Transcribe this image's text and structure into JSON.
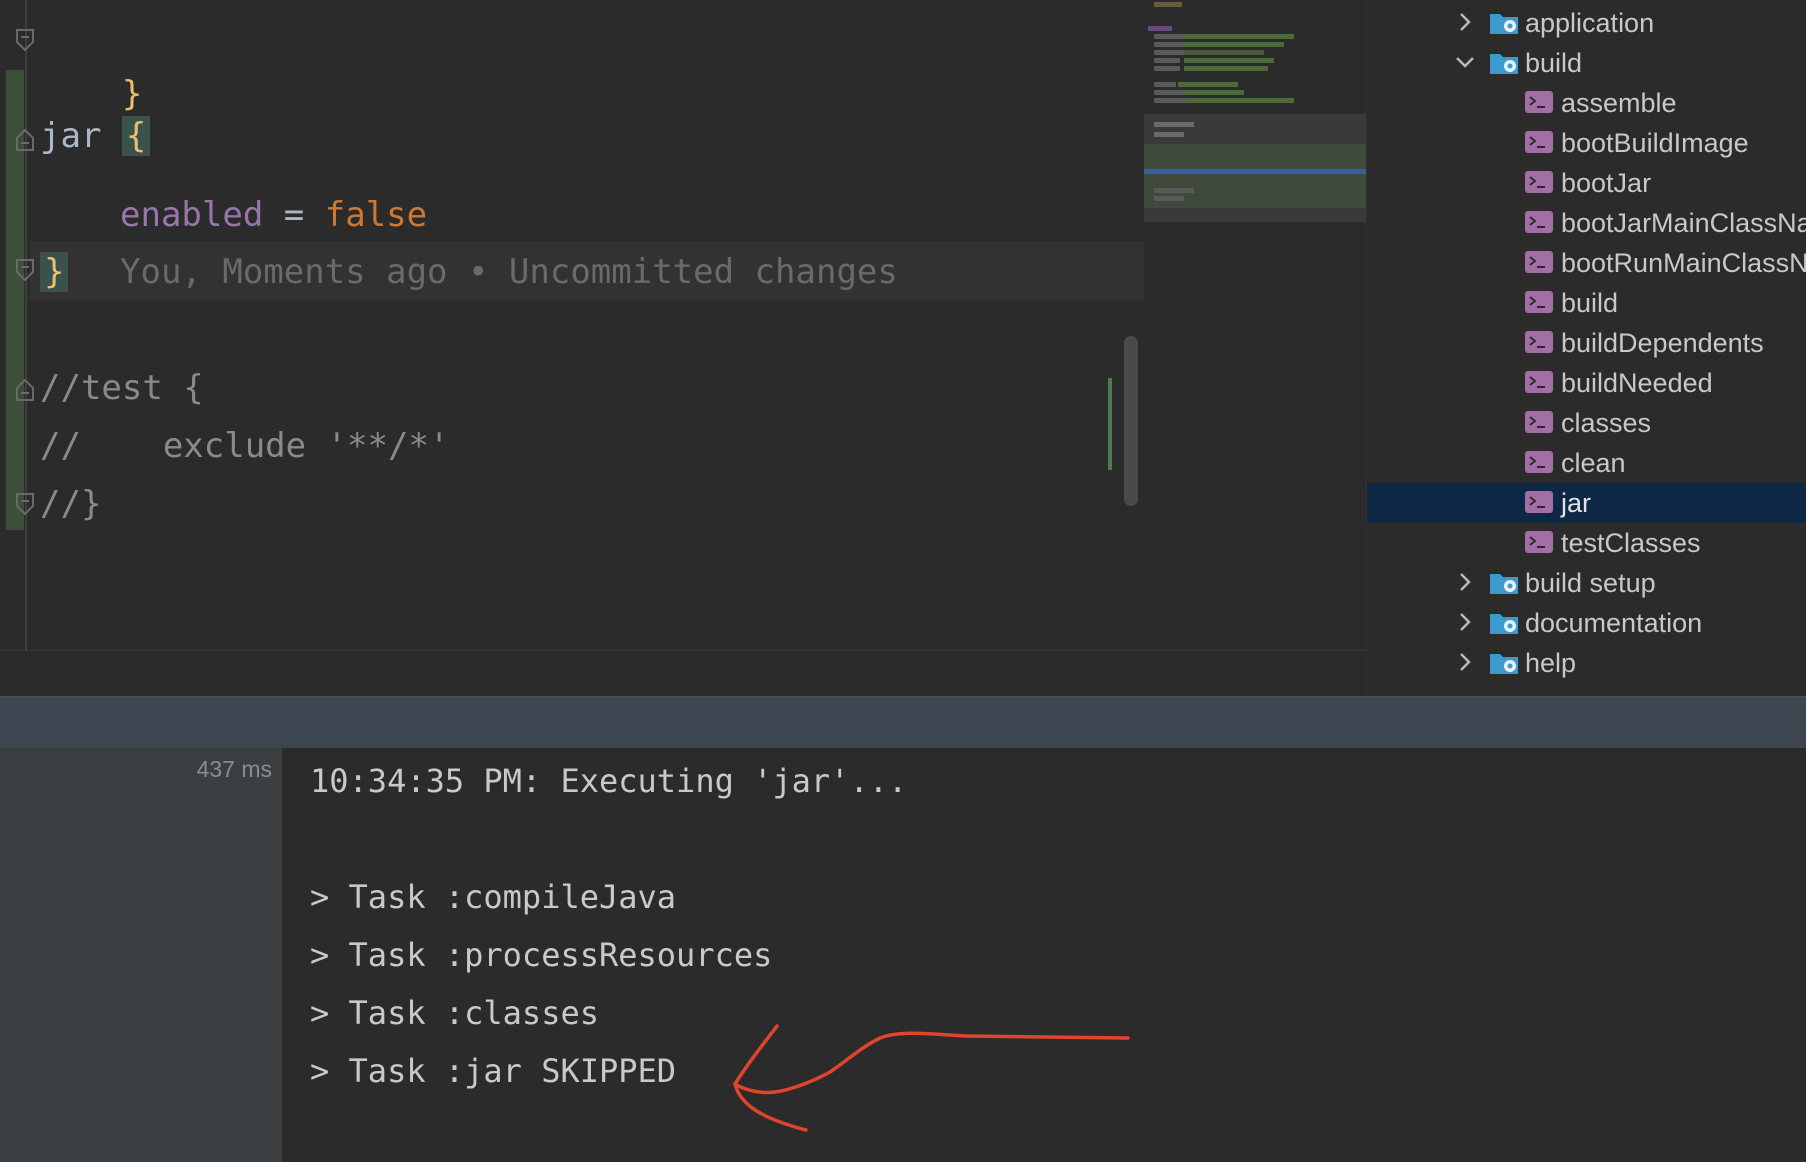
{
  "editor": {
    "lines": {
      "close_brace_1": "}",
      "jar_keyword": "jar",
      "open_brace": "{",
      "enabled_prop": "enabled",
      "equals": "=",
      "false_value": "false",
      "close_brace_2": "}",
      "blame_annotation": "You, Moments ago • Uncommitted changes",
      "comment_1": "//test {",
      "comment_2": "//    exclude '**/*'",
      "comment_3": "//}"
    },
    "colors": {
      "brace": "#e8bf6a",
      "property": "#9876aa",
      "keyword": "#cc7832",
      "comment": "#8a8a8a"
    }
  },
  "gradle_tree": {
    "groups_top": [
      {
        "label": "application",
        "expanded": false
      },
      {
        "label": "build",
        "expanded": true
      }
    ],
    "build_tasks": [
      {
        "label": "assemble"
      },
      {
        "label": "bootBuildImage"
      },
      {
        "label": "bootJar"
      },
      {
        "label": "bootJarMainClassNa"
      },
      {
        "label": "bootRunMainClassN"
      },
      {
        "label": "build"
      },
      {
        "label": "buildDependents"
      },
      {
        "label": "buildNeeded"
      },
      {
        "label": "classes"
      },
      {
        "label": "clean"
      },
      {
        "label": "jar",
        "selected": true
      },
      {
        "label": "testClasses"
      }
    ],
    "groups_bottom": [
      {
        "label": "build setup",
        "expanded": false
      },
      {
        "label": "documentation",
        "expanded": false
      },
      {
        "label": "help",
        "expanded": false
      }
    ],
    "icons": {
      "group": "gradle-folder-icon",
      "task": "gradle-task-icon"
    }
  },
  "run_panel": {
    "duration": "437 ms",
    "console": [
      "10:34:35 PM: Executing 'jar'...",
      "",
      "> Task :compileJava",
      "> Task :processResources",
      "> Task :classes",
      "> Task :jar SKIPPED"
    ],
    "annotation_color": "#e0452c"
  }
}
